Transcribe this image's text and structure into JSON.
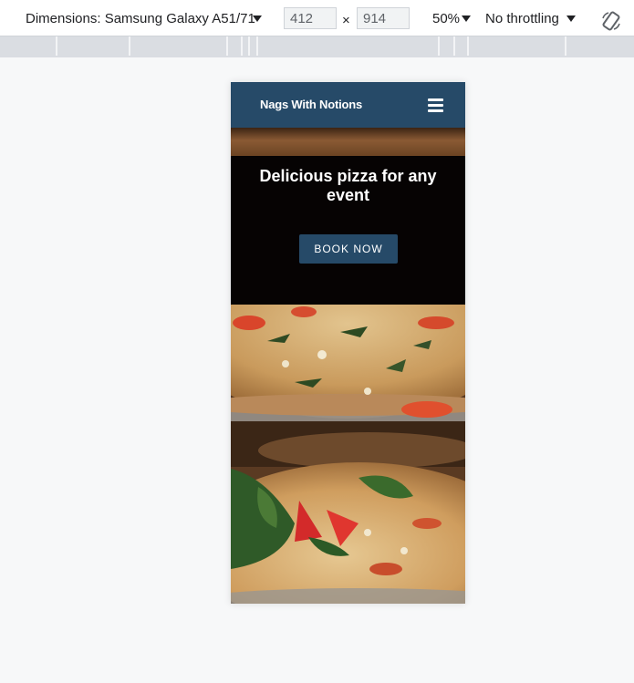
{
  "devtools": {
    "dimensions_label": "Dimensions: Samsung Galaxy A51/71",
    "width_value": "412",
    "times_sign": "×",
    "height_value": "914",
    "zoom_label": "50%",
    "throttling_label": "No throttling",
    "icons": [
      "caret-down-icon",
      "rotate-icon"
    ]
  },
  "site": {
    "brand": "Nags With Notions",
    "menu_icon": "hamburger-icon",
    "hero_title": "Delicious pizza for any event",
    "cta_label": "BOOK NOW",
    "image": "pizza-photo"
  },
  "colors": {
    "header_bg": "#264a68",
    "hero_bg": "#060303",
    "button_bg": "#264a68",
    "ruler_bg": "#dadde2",
    "page_bg": "#f7f8f9"
  }
}
